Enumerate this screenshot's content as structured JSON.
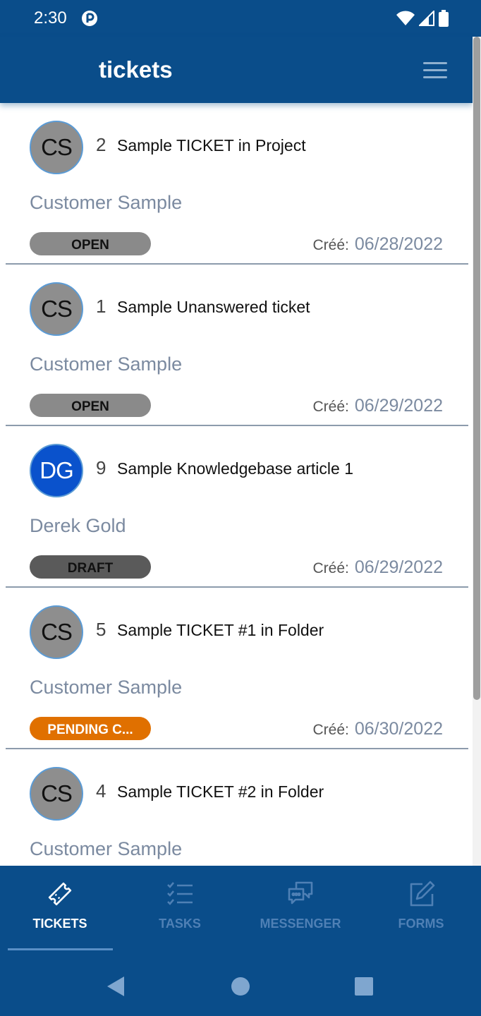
{
  "status_bar": {
    "time": "2:30"
  },
  "app_bar": {
    "title": "tickets"
  },
  "tickets": [
    {
      "initials": "CS",
      "number": "2",
      "subject": "Sample TICKET in Project",
      "customer": "Customer Sample",
      "status": "OPEN",
      "created_label": "Créé:",
      "created_date": "06/28/2022"
    },
    {
      "initials": "CS",
      "number": "1",
      "subject": "Sample Unanswered ticket",
      "customer": "Customer Sample",
      "status": "OPEN",
      "created_label": "Créé:",
      "created_date": "06/29/2022"
    },
    {
      "initials": "DG",
      "number": "9",
      "subject": "Sample Knowledgebase article 1",
      "customer": "Derek Gold",
      "status": "DRAFT",
      "created_label": "Créé:",
      "created_date": "06/29/2022"
    },
    {
      "initials": "CS",
      "number": "5",
      "subject": "Sample TICKET #1 in Folder",
      "customer": "Customer Sample",
      "status": "PENDING C...",
      "created_label": "Créé:",
      "created_date": "06/30/2022"
    },
    {
      "initials": "CS",
      "number": "4",
      "subject": "Sample TICKET #2 in Folder",
      "customer": "Customer Sample"
    }
  ],
  "bottom_nav": [
    {
      "label": "TICKETS",
      "icon": "ticket-icon",
      "active": true
    },
    {
      "label": "TASKS",
      "icon": "tasks-icon"
    },
    {
      "label": "MESSENGER",
      "icon": "messenger-icon"
    },
    {
      "label": "FORMS",
      "icon": "forms-icon"
    }
  ],
  "colors": {
    "primary": "#0a4d8a",
    "open_badge": "#8a8a8a",
    "draft_badge": "#5a5a5a",
    "pending_badge": "#e07000",
    "avatar_blue": "#0a52cc"
  }
}
